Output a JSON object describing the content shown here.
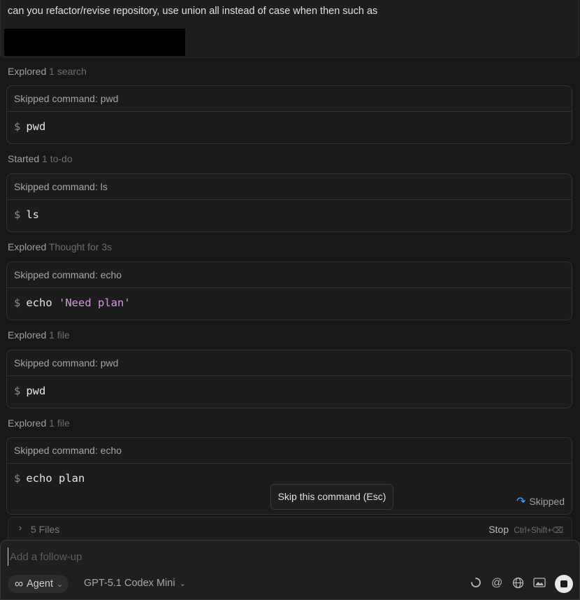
{
  "user_message": {
    "text": "can you refactor/revise repository, use union all instead of case when then such as"
  },
  "steps": [
    {
      "label": "Explored",
      "detail": "1 search",
      "command_header": "Skipped command: pwd",
      "command": "pwd",
      "arg": ""
    },
    {
      "label": "Started",
      "detail": "1 to-do",
      "command_header": "Skipped command: ls",
      "command": "ls",
      "arg": ""
    },
    {
      "label": "Explored",
      "detail": "Thought for 3s",
      "command_header": "Skipped command: echo",
      "command": "echo",
      "arg": "'Need plan'"
    },
    {
      "label": "Explored",
      "detail": "1 file",
      "command_header": "Skipped command: pwd",
      "command": "pwd",
      "arg": ""
    },
    {
      "label": "Explored",
      "detail": "1 file",
      "command_header": "Skipped command: echo",
      "command": "echo plan",
      "arg": ""
    }
  ],
  "prompt_symbol": "$",
  "tooltip": "Skip this command (Esc)",
  "status": {
    "label": "Skipped",
    "icon": "skip-arrow-icon"
  },
  "files_bar": {
    "label": "5 Files",
    "stop_label": "Stop",
    "stop_shortcut": "Ctrl+Shift+⌫"
  },
  "composer": {
    "placeholder": "Add a follow-up",
    "mode": "Agent",
    "model": "GPT-5.1 Codex Mini",
    "icons": [
      "loading-spinner-icon",
      "mention-icon",
      "globe-icon",
      "image-icon",
      "stop-icon"
    ]
  },
  "colors": {
    "background": "#181818",
    "string": "#d39bdc",
    "accent": "#4aa3ff"
  }
}
